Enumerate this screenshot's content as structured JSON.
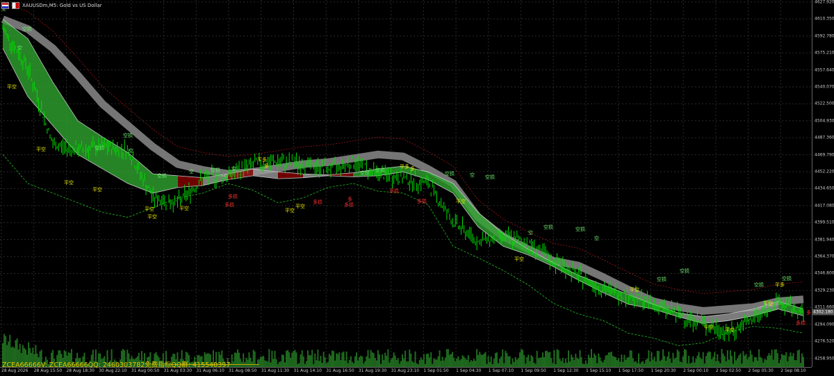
{
  "window": {
    "title": "XAUUSDm,M5:  Gold vs US Dollar",
    "icons": [
      "flag-icon",
      "chart-type-icon"
    ]
  },
  "price_axis": {
    "labels": [
      "4627.920",
      "4610.350",
      "4592.780",
      "4575.210",
      "4557.640",
      "4540.070",
      "4522.500",
      "4504.930",
      "4487.360",
      "4469.790",
      "4452.220",
      "4434.650",
      "4417.080",
      "4399.510",
      "4381.940",
      "4364.370",
      "4346.800",
      "4329.230",
      "4311.660",
      "4294.090",
      "4276.520",
      "4258.950"
    ],
    "current_price": "4302.180"
  },
  "time_axis": {
    "labels": [
      "28 Aug 2026",
      "28 Aug 15:50",
      "28 Aug 18:30",
      "30 Aug 22:10",
      "31 Aug 00:50",
      "31 Aug 03:30",
      "31 Aug 06:10",
      "31 Aug 08:50",
      "31 Aug 11:30",
      "31 Aug 14:10",
      "31 Aug 16:50",
      "31 Aug 19:30",
      "31 Aug 23:10",
      "1 Sep 01:50",
      "1 Sep 04:30",
      "1 Sep 07:10",
      "1 Sep 09:50",
      "1 Sep 12:30",
      "1 Sep 15:10",
      "1 Sep 17:50",
      "1 Sep 20:30",
      "2 Sep 00:10",
      "2 Sep 02:50",
      "2 Sep 05:30",
      "2 Sep 08:10"
    ]
  },
  "watermark": "ZCEA66666V:  ZCEA66666QQ:  2460303782免费指标QQ群:  415540397",
  "signals": {
    "short": "空",
    "short_add": "空损",
    "close_short": "平空",
    "long": "多",
    "long_add": "多损",
    "close_long": "平多"
  },
  "colors": {
    "background": "#000000",
    "grid": "#2b2b2b",
    "band_bull": "#2fa52f",
    "band_bear": "#8b0000",
    "band_neutral": "#9a9a9a",
    "slow_band": "#8a8a8a",
    "candles": "#00dd00",
    "volume": "#1f6b1f",
    "watermark": "#e6c200"
  },
  "chart_data": {
    "type": "line",
    "title": "XAUUSDm,M5:  Gold vs US Dollar",
    "xlabel": "",
    "ylabel": "",
    "ylim": [
      4250.0,
      4630.0
    ],
    "grid": true,
    "x": [
      "28 Aug 2026",
      "28 Aug 15:50",
      "28 Aug 18:30",
      "30 Aug 22:10",
      "31 Aug 00:50",
      "31 Aug 03:30",
      "31 Aug 06:10",
      "31 Aug 08:50",
      "31 Aug 11:30",
      "31 Aug 14:10",
      "31 Aug 16:50",
      "31 Aug 19:30",
      "31 Aug 23:10",
      "1 Sep 01:50",
      "1 Sep 04:30",
      "1 Sep 07:10",
      "1 Sep 09:50",
      "1 Sep 12:30",
      "1 Sep 15:10",
      "1 Sep 17:50",
      "1 Sep 20:30",
      "2 Sep 00:10",
      "2 Sep 02:50",
      "2 Sep 05:30",
      "2 Sep 08:10"
    ],
    "series": [
      {
        "values": [
          4600,
          4560,
          4480,
          4475,
          4478,
          4475,
          4425,
          4420,
          4445,
          4448,
          4460,
          4462,
          4460,
          4455,
          4462,
          4450,
          4445,
          4440,
          4400,
          4380,
          4385,
          4378,
          4360,
          4345,
          4330,
          4325,
          4315,
          4305,
          4295,
          4285,
          4300,
          4318,
          4305
        ]
      },
      {
        "values": [
          4610,
          4590,
          4545,
          4505,
          4488,
          4472,
          4450,
          4448,
          4446,
          4450,
          4455,
          4452,
          4450,
          4449,
          4451,
          4455,
          4458,
          4452,
          4440,
          4410,
          4388,
          4372,
          4358,
          4345,
          4335,
          4325,
          4315,
          4306,
          4302,
          4305,
          4310,
          4318,
          4310
        ]
      },
      {
        "values": [
          4580,
          4530,
          4500,
          4470,
          4455,
          4440,
          4430,
          4436,
          4438,
          4444,
          4448,
          4445,
          4446,
          4448,
          4447,
          4448,
          4452,
          4444,
          4430,
          4395,
          4375,
          4366,
          4354,
          4340,
          4327,
          4315,
          4310,
          4302,
          4295,
          4298,
          4303,
          4310,
          4303
        ]
      },
      {
        "values": [
          4470,
          4440,
          4430,
          4420,
          4410,
          4405,
          4415,
          4425,
          4430,
          4440,
          4433,
          4420,
          4425,
          4436,
          4440,
          4432,
          4430,
          4418,
          4375,
          4363,
          4350,
          4335,
          4316,
          4305,
          4298,
          4285,
          4280,
          4272,
          4275,
          4286,
          4292,
          4290,
          4285
        ]
      },
      {
        "values": [
          4610,
          4600,
          4580,
          4552,
          4522,
          4500,
          4478,
          4460,
          4454,
          4450,
          4452,
          4456,
          4460,
          4462,
          4466,
          4470,
          4468,
          4455,
          4440,
          4405,
          4385,
          4372,
          4360,
          4355,
          4343,
          4330,
          4318,
          4312,
          4308,
          4310,
          4312,
          4318,
          4320
        ]
      }
    ]
  }
}
